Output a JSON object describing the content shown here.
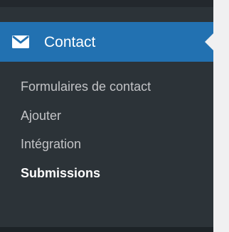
{
  "menu": {
    "title": "Contact",
    "icon": "mail-icon",
    "submenu": [
      {
        "label": "Formulaires de contact"
      },
      {
        "label": "Ajouter"
      },
      {
        "label": "Intégration"
      },
      {
        "label": "Submissions",
        "current": true
      }
    ]
  },
  "colors": {
    "sidebar_bg": "#2c3338",
    "active_bg": "#2271b1",
    "submenu_text": "#c3c4c7",
    "active_text": "#ffffff",
    "content_bg": "#f0f0f1"
  }
}
